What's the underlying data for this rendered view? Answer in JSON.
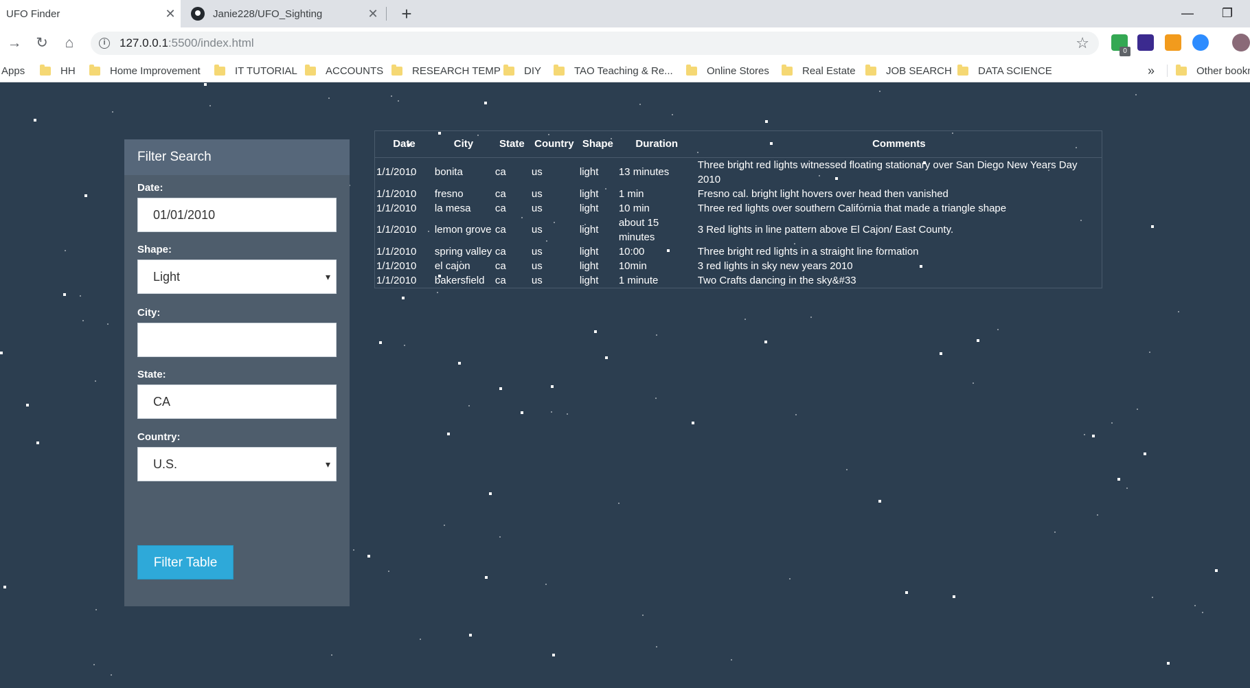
{
  "browser": {
    "tabs": [
      {
        "title": "UFO Finder",
        "active": true
      },
      {
        "title": "Janie228/UFO_Sighting",
        "active": false
      }
    ],
    "new_tab": "+",
    "url_host": "127.0.0.1",
    "url_rest": ":5500/index.html",
    "window_controls": {
      "minimize": "—",
      "restore": "❐"
    },
    "bookmarks": [
      "Apps",
      "HH",
      "Home Improvement",
      "IT TUTORIAL",
      "ACCOUNTS",
      "RESEARCH TEMP",
      "DIY",
      "TAO Teaching & Re...",
      "Online Stores",
      "Real Estate",
      "JOB SEARCH",
      "DATA SCIENCE"
    ],
    "bookmarks_overflow": "»",
    "other_bookmarks": "Other bookm",
    "extension_badge": "0"
  },
  "filter": {
    "title": "Filter Search",
    "date_label": "Date:",
    "date_value": "01/01/2010",
    "shape_label": "Shape:",
    "shape_value": "Light",
    "city_label": "City:",
    "city_value": "",
    "state_label": "State:",
    "state_value": "CA",
    "country_label": "Country:",
    "country_value": "U.S.",
    "button_label": "Filter Table"
  },
  "table": {
    "headers": [
      "Date",
      "City",
      "State",
      "Country",
      "Shape",
      "Duration",
      "Comments"
    ],
    "rows": [
      [
        "1/1/2010",
        "bonita",
        "ca",
        "us",
        "light",
        "13 minutes",
        "Three bright red lights witnessed floating stationary over San Diego New Years Day 2010"
      ],
      [
        "1/1/2010",
        "fresno",
        "ca",
        "us",
        "light",
        "1 min",
        "Fresno cal. bright light hovers over head then vanished"
      ],
      [
        "1/1/2010",
        "la mesa",
        "ca",
        "us",
        "light",
        "10 min",
        "Three red lights over southern California that made a triangle shape"
      ],
      [
        "1/1/2010",
        "lemon grove",
        "ca",
        "us",
        "light",
        "about 15 minutes",
        "3 Red lights in line pattern above El Cajon/ East County."
      ],
      [
        "1/1/2010",
        "spring valley",
        "ca",
        "us",
        "light",
        "10:00",
        "Three bright red lights in a straight line formation"
      ],
      [
        "1/1/2010",
        "el cajon",
        "ca",
        "us",
        "light",
        "10min",
        "3 red lights in sky new years 2010"
      ],
      [
        "1/1/2010",
        "bakersfield",
        "ca",
        "us",
        "light",
        "1 minute",
        "Two Crafts dancing in the sky&#33"
      ]
    ]
  },
  "icons": {
    "close": "close-icon",
    "back": "back-arrow-icon",
    "reload": "reload-icon",
    "home": "home-icon",
    "info": "info-icon",
    "star": "bookmark-star-icon",
    "folder": "folder-icon"
  }
}
